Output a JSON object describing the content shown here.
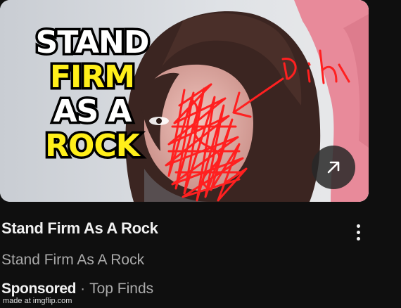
{
  "thumbnail": {
    "line1": "STAND",
    "line2": "FIRM",
    "line3": "AS A",
    "line4": "ROCK"
  },
  "doodle": {
    "text": "Dih",
    "color": "#ff2020"
  },
  "video": {
    "title": "Stand Firm As A Rock",
    "channel": "Stand Firm As A Rock",
    "sponsored": "Sponsored",
    "separator": "·",
    "source": "Top Finds"
  },
  "watermark": "made at imgflip.com",
  "icons": {
    "open": "external-link-arrow-icon",
    "more": "more-vertical-icon"
  },
  "colors": {
    "background": "#0f0f0f",
    "title": "#f1f1f1",
    "secondary": "#aaaaaa",
    "thumb_text_white": "#ffffff",
    "thumb_text_yellow": "#ffef1a"
  }
}
